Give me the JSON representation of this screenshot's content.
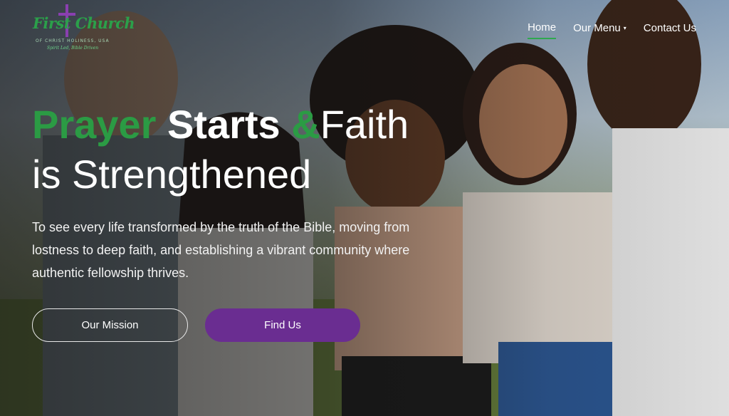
{
  "logo": {
    "title": "First Church",
    "subtitle": "OF CHRIST HOLINESS, USA",
    "tagline": "Spirit Led, Bible Driven"
  },
  "nav": {
    "items": [
      {
        "label": "Home"
      },
      {
        "label": "Our Menu"
      },
      {
        "label": "Contact Us"
      }
    ],
    "active": "Home"
  },
  "hero": {
    "headline": {
      "word1": "Prayer",
      "word2": "Starts",
      "amp": "&",
      "word3": "Faith",
      "line2": "is Strengthened"
    },
    "description": "To see every life transformed by the truth of the Bible, moving from lostness to deep faith, and establishing a vibrant community where authentic fellowship thrives.",
    "buttons": {
      "primary": "Our Mission",
      "secondary": "Find Us"
    }
  },
  "colors": {
    "accent_green": "#2b9b44",
    "brand_purple": "#6a2d91"
  }
}
